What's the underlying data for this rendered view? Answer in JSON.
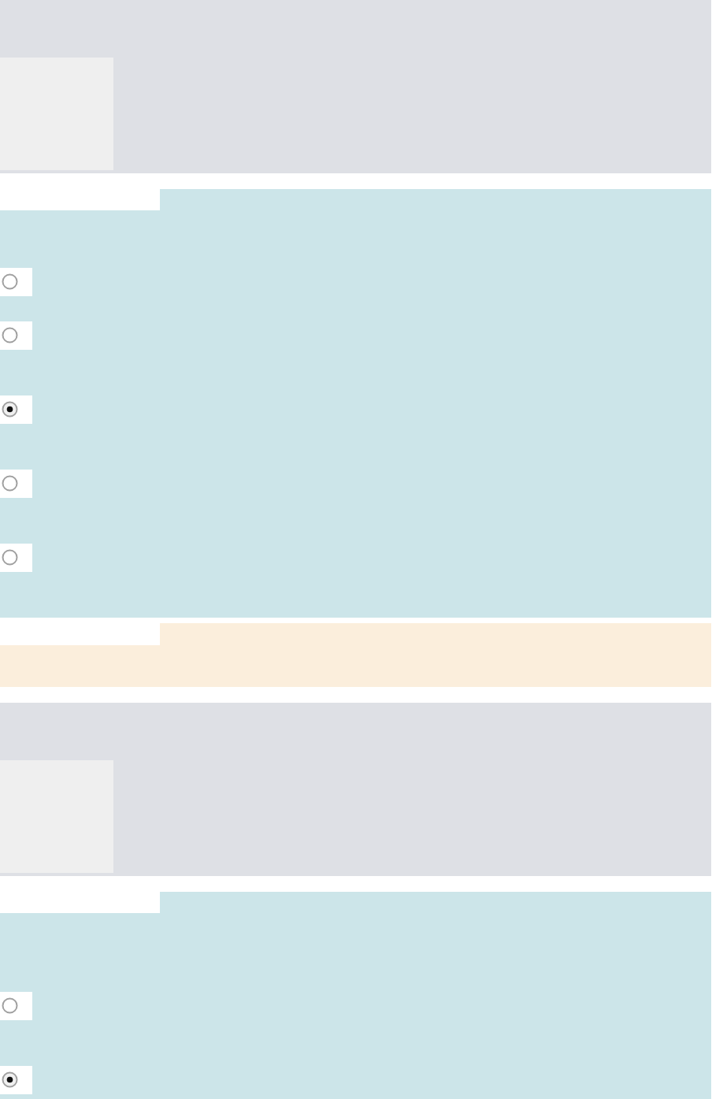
{
  "sections": [
    {
      "kind": "info"
    },
    {
      "kind": "question",
      "options": [
        {
          "selected": false
        },
        {
          "selected": false
        },
        {
          "selected": true
        },
        {
          "selected": false
        },
        {
          "selected": false
        }
      ]
    },
    {
      "kind": "feedback"
    },
    {
      "kind": "info"
    },
    {
      "kind": "question",
      "options": [
        {
          "selected": false
        },
        {
          "selected": true
        }
      ]
    }
  ]
}
